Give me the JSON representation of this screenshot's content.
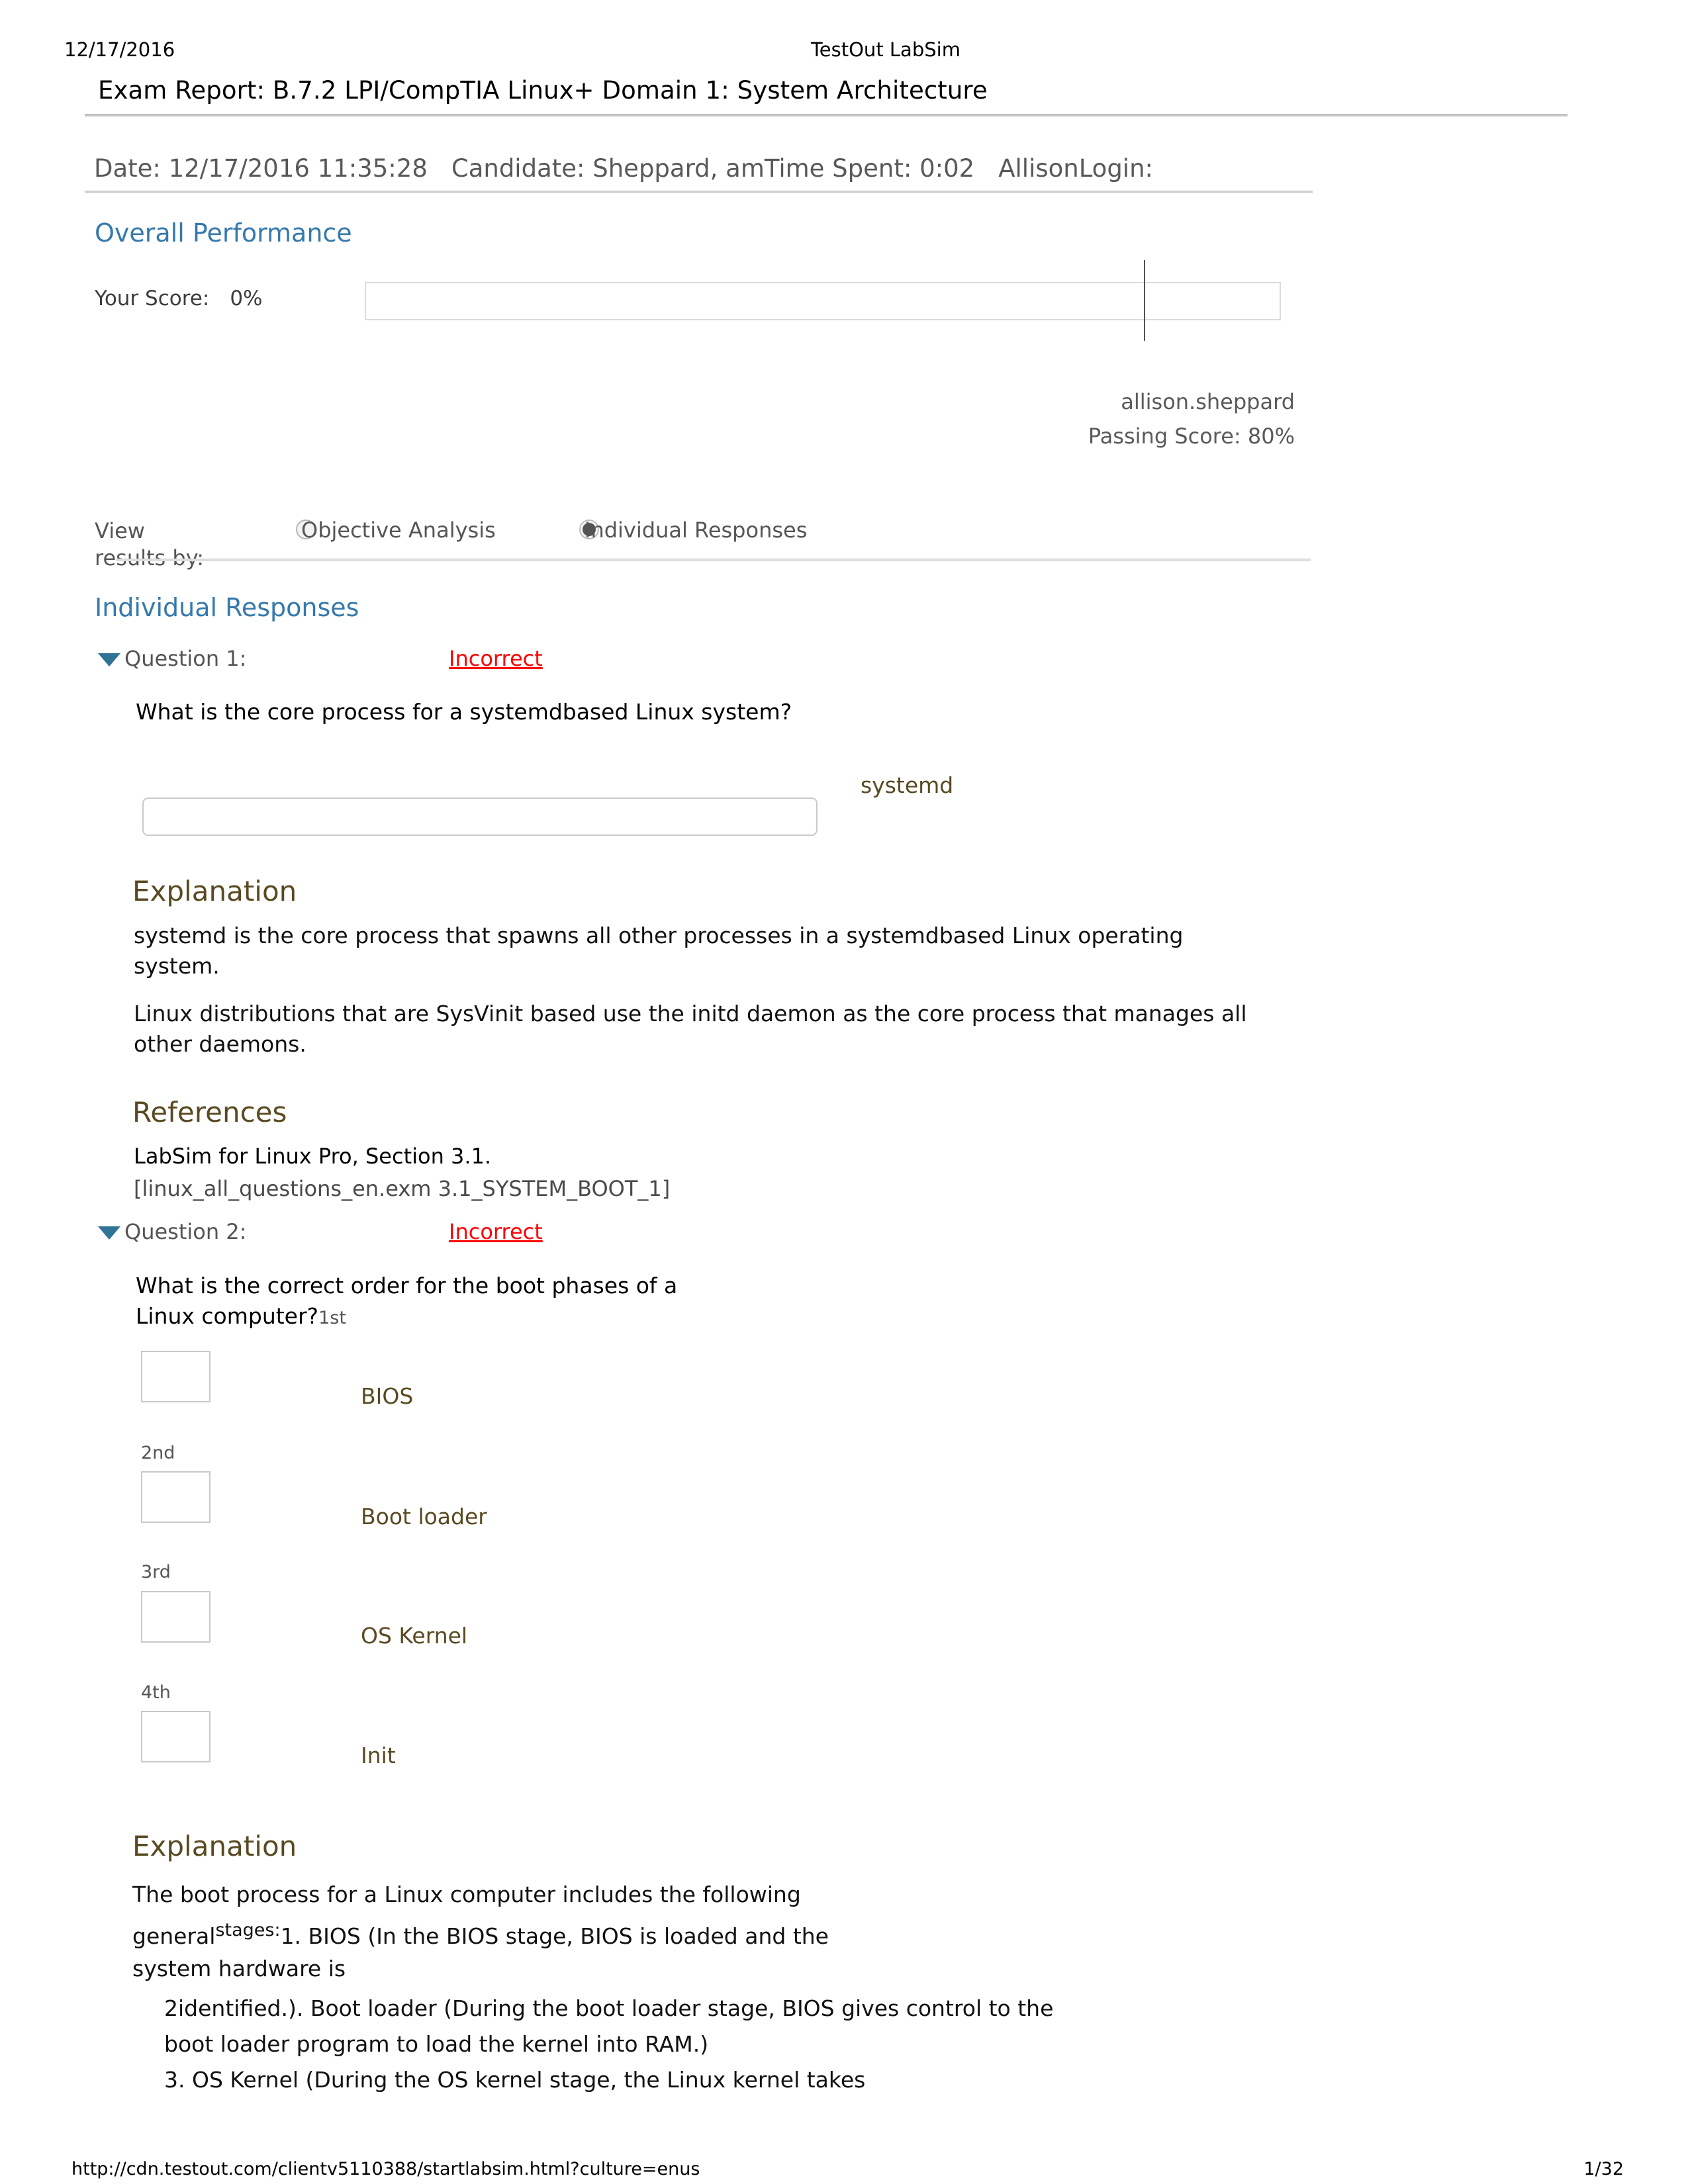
{
  "print_header": {
    "date": "12/17/2016",
    "app_title": "TestOut LabSim"
  },
  "report": {
    "title": "Exam Report: B.7.2 LPI/CompTIA Linux+ Domain 1: System Architecture",
    "meta": {
      "date_label": "Date: 12/17/2016 11:35:28",
      "candidate_label": "Candidate: Sheppard, am",
      "time_spent_label": "Time Spent: 0:02",
      "login_label": "AllisonLogin:"
    }
  },
  "overall_performance": {
    "heading": "Overall Performance",
    "your_score_label": "Your Score:",
    "your_score_value": "0%",
    "score_percent": 0,
    "passing_percent": 80,
    "username": "allison.sheppard",
    "passing_score_text": "Passing Score: 80%"
  },
  "view_results": {
    "label": "View results by:",
    "options": [
      {
        "label": "Objective Analysis",
        "selected": false
      },
      {
        "label": "Individual Responses",
        "selected": true
      }
    ]
  },
  "individual_responses": {
    "heading": "Individual Responses",
    "questions": [
      {
        "number_label": "Question 1:",
        "status": "Incorrect",
        "prompt": "What is the core process for a systemdbased Linux system?",
        "answer": "systemd",
        "explanation_heading": "Explanation",
        "explanation_paragraphs": [
          "systemd is the core process that spawns all other processes in a systemdbased Linux operating system.",
          "Linux distributions that are SysVinit based use the initd daemon as the core process that manages all other daemons."
        ],
        "references_heading": "References",
        "references": [
          "LabSim for Linux Pro, Section 3.1.",
          "[linux_all_questions_en.exm 3.1_SYSTEM_BOOT_1]"
        ]
      },
      {
        "number_label": "Question 2:",
        "status": "Incorrect",
        "prompt": "What is the correct order for the boot phases of a Linux computer?",
        "ordering": [
          {
            "ordinal": "1st",
            "answer": "BIOS"
          },
          {
            "ordinal": "2nd",
            "answer": "Boot loader"
          },
          {
            "ordinal": "3rd",
            "answer": "OS Kernel"
          },
          {
            "ordinal": "4th",
            "answer": "Init"
          }
        ],
        "explanation_heading": "Explanation",
        "explanation_lead": "The boot process for a Linux computer includes the following",
        "explanation_general": "general",
        "explanation_stages_sup": "stages:",
        "explanation_line_1": "1. BIOS (In the BIOS stage, BIOS is loaded and the",
        "explanation_line_2": "system hardware is",
        "explanation_line_3": "2identified.). Boot loader (During the boot loader stage, BIOS gives control to the",
        "explanation_line_4": "boot loader program to load the kernel into RAM.)",
        "explanation_line_5": "3. OS Kernel (During the OS kernel stage, the Linux kernel takes"
      }
    ]
  },
  "footer": {
    "url": "http://cdn.testout.com/clientv5110388/startlabsim.html?culture=enus",
    "page": "1/32"
  },
  "colors": {
    "section_heading_blue": "#3679ac",
    "sub_heading_olive": "#5a4a22",
    "incorrect_red": "#ff0000",
    "answer_olive": "#5a4a22",
    "meta_gray": "#595959"
  }
}
